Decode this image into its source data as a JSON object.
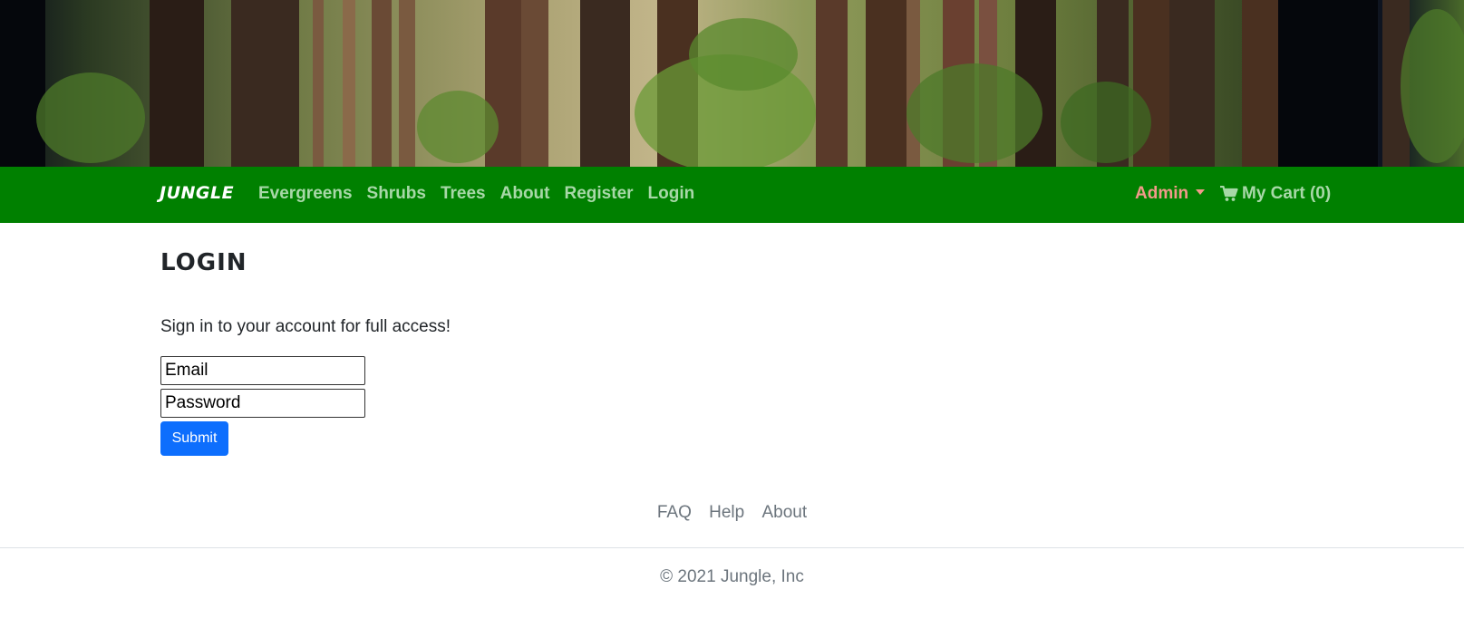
{
  "navbar": {
    "brand": "JUNGLE",
    "links": [
      "Evergreens",
      "Shrubs",
      "Trees",
      "About",
      "Register",
      "Login"
    ],
    "admin_label": "Admin",
    "cart_label": "My Cart (0)",
    "cart_icon": "shopping-cart-icon"
  },
  "main": {
    "title": "LOGIN",
    "intro": "Sign in to your account for full access!",
    "email_placeholder": "Email",
    "password_placeholder": "Password",
    "submit_label": "Submit"
  },
  "footer": {
    "links": [
      "FAQ",
      "Help",
      "About"
    ],
    "copyright": "© 2021 Jungle, Inc"
  },
  "colors": {
    "navbar_bg": "#008000",
    "nav_link": "#a8d8a8",
    "admin": "#f29a8a",
    "submit_bg": "#0d6efd",
    "footer_text": "#6c757d"
  }
}
